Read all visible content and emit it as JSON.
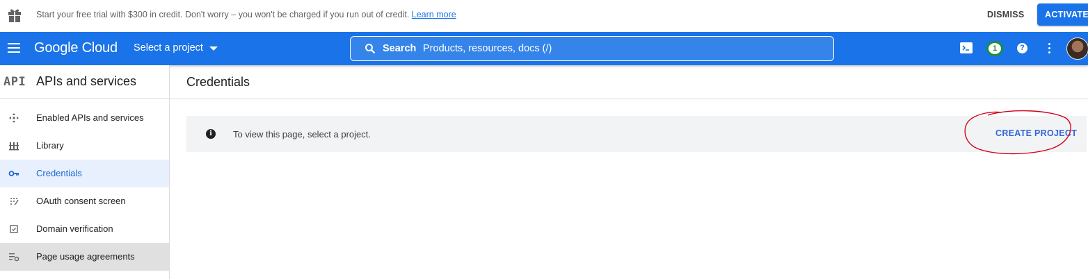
{
  "banner": {
    "text": "Start your free trial with $300 in credit. Don't worry – you won't be charged if you run out of credit.",
    "link": "Learn more",
    "dismiss": "DISMISS",
    "activate": "ACTIVATE"
  },
  "topnav": {
    "brand": "Google Cloud",
    "project_picker": "Select a project",
    "search_label": "Search",
    "search_hint": "Products, resources, docs (/)",
    "notification_count": "1",
    "help": "?"
  },
  "sidebar": {
    "logo": "API",
    "title": "APIs and services",
    "items": [
      {
        "label": "Enabled APIs and services",
        "icon": "hub-icon"
      },
      {
        "label": "Library",
        "icon": "library-icon"
      },
      {
        "label": "Credentials",
        "icon": "key-icon"
      },
      {
        "label": "OAuth consent screen",
        "icon": "consent-icon"
      },
      {
        "label": "Domain verification",
        "icon": "checkbox-icon"
      },
      {
        "label": "Page usage agreements",
        "icon": "settings-list-icon"
      }
    ]
  },
  "main": {
    "title": "Credentials",
    "info": "To view this page, select a project.",
    "create_project": "CREATE PROJECT"
  },
  "colors": {
    "brand_blue": "#1a73e8",
    "annotation_red": "#d0021b"
  }
}
